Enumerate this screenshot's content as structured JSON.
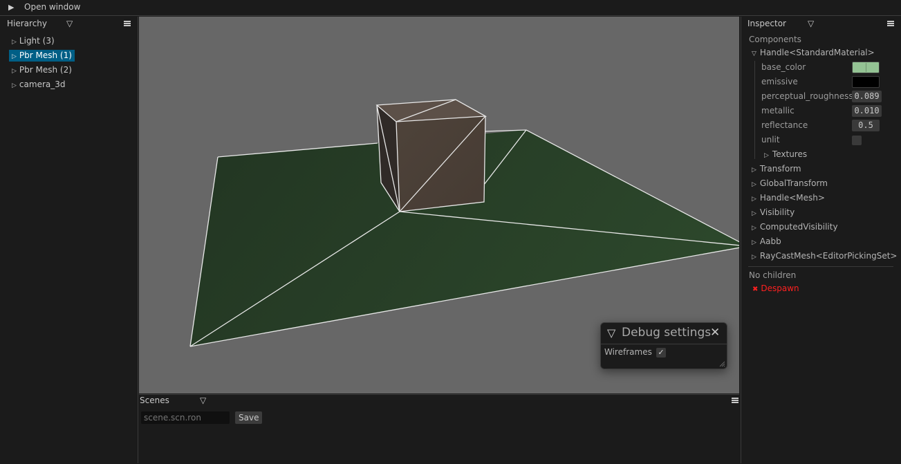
{
  "topbar": {
    "play_icon": "play-icon",
    "label": "Open window"
  },
  "hierarchy": {
    "title": "Hierarchy",
    "items": [
      {
        "label": "Light (3)",
        "selected": false
      },
      {
        "label": "Pbr Mesh (1)",
        "selected": true
      },
      {
        "label": "Pbr Mesh (2)",
        "selected": false
      },
      {
        "label": "camera_3d",
        "selected": false
      }
    ]
  },
  "inspector": {
    "title": "Inspector",
    "components_label": "Components",
    "material": {
      "label": "Handle<StandardMaterial>",
      "fields": {
        "base_color": {
          "label": "base_color",
          "color": "#94c394"
        },
        "emissive": {
          "label": "emissive",
          "color": "#000000"
        },
        "perceptual_roughness": {
          "label": "perceptual_roughness",
          "value": "0.089"
        },
        "metallic": {
          "label": "metallic",
          "value": "0.010"
        },
        "reflectance": {
          "label": "reflectance",
          "value": "0.5"
        },
        "unlit": {
          "label": "unlit",
          "checked": false
        }
      },
      "textures_label": "Textures"
    },
    "components": [
      "Transform",
      "GlobalTransform",
      "Handle<Mesh>",
      "Visibility",
      "ComputedVisibility",
      "Aabb",
      "RayCastMesh<EditorPickingSet>"
    ],
    "no_children": "No children",
    "despawn": {
      "icon": "x-icon",
      "label": "Despawn",
      "color": "#ff2020"
    }
  },
  "scenes": {
    "title": "Scenes",
    "input_placeholder": "scene.scn.ron",
    "save_label": "Save"
  },
  "debug_settings": {
    "title": "Debug settings",
    "wireframes_label": "Wireframes",
    "wireframes_checked": true,
    "check_glyph": "✓",
    "close_glyph": "✕",
    "collapse_glyph": "▽"
  },
  "glyphs": {
    "tree_collapsed": "▷",
    "tree_expanded": "▽",
    "panel_dropdown": "▽",
    "play": "▶",
    "despawn_x": "✖"
  },
  "colors": {
    "selection": "#005f86",
    "viewport_bg": "#676767",
    "ground": "#273d26",
    "cube": "#4a3f37",
    "wire": "#e8e8e8"
  }
}
